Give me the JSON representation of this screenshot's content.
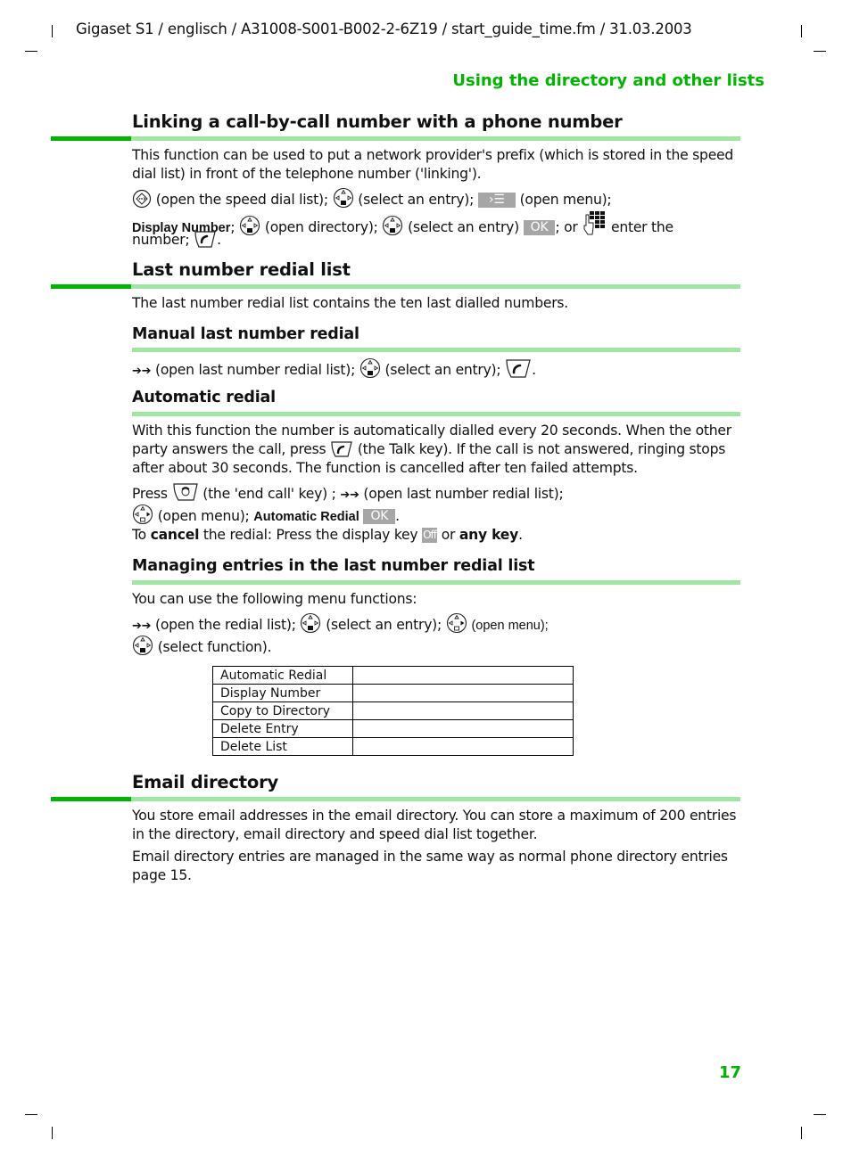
{
  "header": {
    "doc_info": "Gigaset S1 / englisch / A31008-S001-B002-2-6Z19 / start_guide_time.fm / 31.03.2003",
    "running_head": "Using the directory and other lists"
  },
  "sections": {
    "linking": {
      "title": "Linking a call-by-call number with a phone number",
      "intro": "This function can be used to put a network provider's prefix (which is stored in the speed dial list) in front of the telephone number ('linking').",
      "step1_a": "(open the speed dial list);",
      "step1_b": "(select an entry);",
      "menu_key_glyph": "›☰",
      "step1_c": "(open menu);",
      "step2_label": "Display Number",
      "step2_sep": ";",
      "step2_a": "(open directory);",
      "step2_b": "(select an entry)",
      "ok_label": "OK",
      "step2_c": "; or",
      "step2_d": "enter the",
      "step3": "number;",
      "step3_end": "."
    },
    "redial_list": {
      "title": "Last number redial list",
      "intro": "The last number redial list contains the ten last dialled numbers."
    },
    "manual_redial": {
      "title": "Manual last number redial",
      "arrow": "➔➔",
      "step_a": "(open last number redial list);",
      "step_b": "(select an entry);",
      "step_end": "."
    },
    "automatic_redial": {
      "title": "Automatic redial",
      "intro": "With this function the number is automatically dialled every 20 seconds. When the other party answers the call, press",
      "intro_b": "(the Talk key). If the call is not answered, ringing stops after about 30 seconds. The function is cancelled after ten failed attempts.",
      "press": "Press",
      "end_call": "(the 'end call' key) ;",
      "arrow": "➔➔",
      "open_list": "(open last number redial list);",
      "open_menu": "(open menu);",
      "menu_item": "Automatic Redial",
      "ok_label": "OK",
      "menu_end": ".",
      "cancel_a": "To",
      "cancel_bold": "cancel",
      "cancel_b": "the redial: Press the display key",
      "off_label": "Off",
      "cancel_c": "or",
      "any_key": "any key",
      "cancel_end": "."
    },
    "managing": {
      "title": "Managing entries in the last number redial list",
      "intro": "You can use the following menu functions:",
      "arrow": "➔➔",
      "step_a": "(open the redial list);",
      "step_b": "(select an entry);",
      "step_c": "(open menu);",
      "step_d": "(select function).",
      "menu_functions": [
        {
          "name": "Automatic Redial",
          "description": ""
        },
        {
          "name": "Display Number",
          "description": ""
        },
        {
          "name": "Copy to Directory",
          "description": ""
        },
        {
          "name": "Delete Entry",
          "description": ""
        },
        {
          "name": "Delete List",
          "description": ""
        }
      ]
    },
    "email": {
      "title": "Email directory",
      "p1": "You store email addresses in the email directory. You can store a maximum of 200 entries in the directory, email directory and speed dial list together.",
      "p2": "Email directory entries are managed in the same way as normal phone directory entries page 15."
    }
  },
  "footer": {
    "page_number": "17"
  },
  "colors": {
    "accent_green": "#00b400",
    "rule_light_green": "#a0e6a3",
    "softkey_gray": "#a6a6a6"
  },
  "icons": {
    "speed_dial_key": "speed-dial-key-icon",
    "control_key": "control-key-icon",
    "talk_key": "talk-key-icon",
    "end_call_key": "end-call-key-icon",
    "keypad": "keypad-icon",
    "redial_arrows": "redial-arrow-icon"
  }
}
